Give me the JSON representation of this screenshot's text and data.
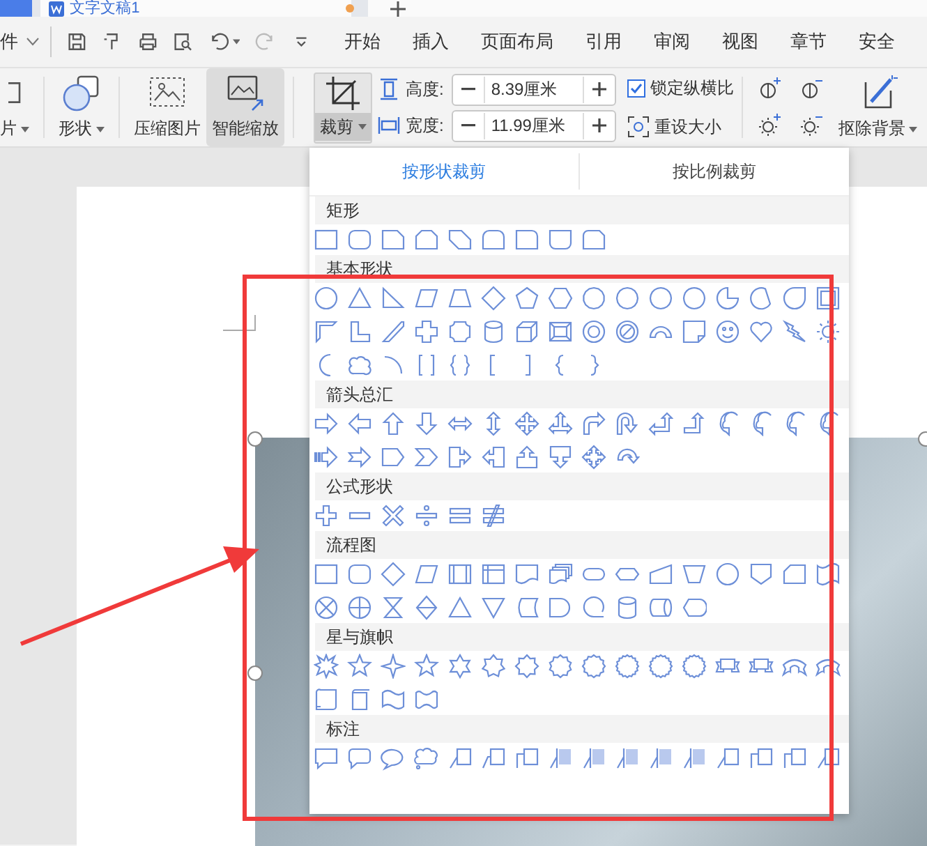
{
  "tabs": [
    {
      "title": "文字文稿1",
      "selected": true
    }
  ],
  "quick_bar": {
    "file_menu": "件"
  },
  "menu": [
    {
      "label": "开始",
      "selected": false
    },
    {
      "label": "插入",
      "selected": false
    },
    {
      "label": "页面布局",
      "selected": false
    },
    {
      "label": "引用",
      "selected": false
    },
    {
      "label": "审阅",
      "selected": false
    },
    {
      "label": "视图",
      "selected": false
    },
    {
      "label": "章节",
      "selected": false
    },
    {
      "label": "安全",
      "selected": false
    }
  ],
  "ribbon": {
    "picture_button": "片",
    "shape_button": "形状",
    "compress_button": "压缩图片",
    "smart_scale": {
      "label": "智能缩放",
      "selected": true
    },
    "crop": {
      "label": "裁剪",
      "selected": true
    },
    "height": {
      "label": "高度:",
      "value": "8.39厘米"
    },
    "width": {
      "label": "宽度:",
      "value": "11.99厘米"
    },
    "lock_ratio": {
      "label": "锁定纵横比",
      "checked": true
    },
    "reset_size": "重设大小",
    "remove_background": "抠除背景"
  },
  "crop_panel": {
    "tabs": [
      {
        "label": "按形状裁剪",
        "selected": true
      },
      {
        "label": "按比例裁剪",
        "selected": false
      }
    ],
    "sections": [
      {
        "title": "矩形"
      },
      {
        "title": "基本形状"
      },
      {
        "title": "箭头总汇"
      },
      {
        "title": "公式形状"
      },
      {
        "title": "流程图"
      },
      {
        "title": "星与旗帜"
      },
      {
        "title": "标注"
      }
    ]
  }
}
